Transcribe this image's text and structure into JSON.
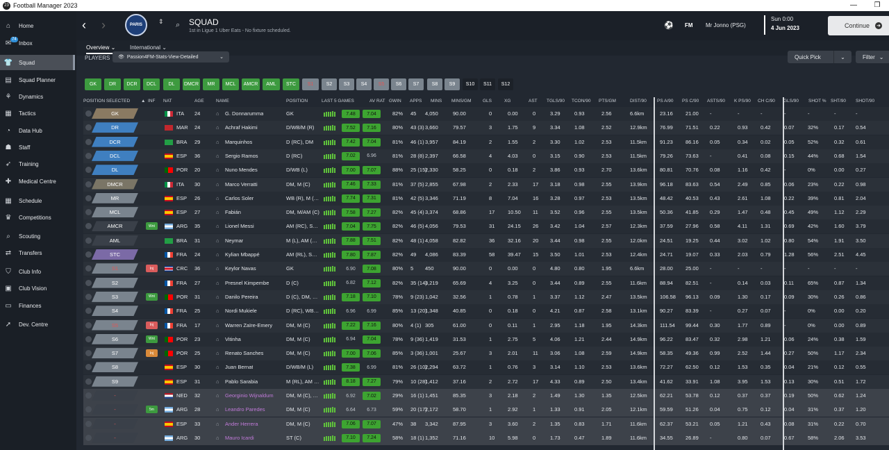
{
  "window": {
    "title": "Football Manager 2023",
    "logo_text": "23",
    "min": "—",
    "restore": "❐"
  },
  "sidebar": {
    "items": [
      {
        "label": "Home",
        "icon": "home-icon",
        "glyph": "⌂"
      },
      {
        "label": "Inbox",
        "icon": "inbox-icon",
        "glyph": "✉",
        "badge": "74"
      },
      {
        "label": "Squad",
        "icon": "shirt-icon",
        "glyph": "👕",
        "active": true
      },
      {
        "label": "Squad Planner",
        "icon": "planner-icon",
        "glyph": "▤"
      },
      {
        "label": "Dynamics",
        "icon": "dynamics-icon",
        "glyph": "⚘"
      },
      {
        "label": "Tactics",
        "icon": "tactics-icon",
        "glyph": "▦"
      },
      {
        "label": "Data Hub",
        "icon": "data-hub-icon",
        "glyph": "◔"
      },
      {
        "label": "Staff",
        "icon": "staff-icon",
        "glyph": "☗"
      },
      {
        "label": "Training",
        "icon": "training-icon",
        "glyph": "➶"
      },
      {
        "label": "Medical Centre",
        "icon": "medical-icon",
        "glyph": "✚"
      },
      {
        "label": "Schedule",
        "icon": "schedule-icon",
        "glyph": "▦"
      },
      {
        "label": "Competitions",
        "icon": "trophy-icon",
        "glyph": "♛"
      },
      {
        "label": "Scouting",
        "icon": "scouting-icon",
        "glyph": "⌕"
      },
      {
        "label": "Transfers",
        "icon": "transfers-icon",
        "glyph": "⇄"
      },
      {
        "label": "Club Info",
        "icon": "shield-icon",
        "glyph": "⛉"
      },
      {
        "label": "Club Vision",
        "icon": "vision-icon",
        "glyph": "▣"
      },
      {
        "label": "Finances",
        "icon": "finances-icon",
        "glyph": "▭"
      },
      {
        "label": "Dev. Centre",
        "icon": "dev-centre-icon",
        "glyph": "➚"
      }
    ]
  },
  "header": {
    "back": "‹",
    "forward": "›",
    "crest": "PARIS",
    "title": "SQUAD",
    "subtitle": "1st in Ligue 1 Uber Eats - No fixture scheduled.",
    "fm": "FM",
    "manager": "Mr Jonno (PSG)",
    "day": "Sun 0:00",
    "date": "4 Jun 2023",
    "continue": "Continue"
  },
  "tabs": {
    "overview": "Overview",
    "international": "International"
  },
  "players_label": "PLAYERS",
  "view": "Passion4FM-Stats-View-Detailed",
  "quick_pick": "Quick Pick",
  "filter": "Filter",
  "position_buttons": [
    "GK",
    "DR",
    "DCR",
    "DCL",
    "DL",
    "DMCR",
    "MR",
    "MCL",
    "AMCR",
    "AML",
    "STC",
    "S1",
    "S2",
    "S3",
    "S4",
    "S5",
    "S6",
    "S7",
    "S8",
    "S9",
    "S10",
    "S11",
    "S12"
  ],
  "columns": [
    "POSITION SELECTED",
    "INF",
    "NAT",
    "AGE",
    "NAME",
    "POSITION",
    "LAST 5 GAMES",
    "AV RAT",
    "GWIN",
    "APPS",
    "MINS",
    "MINS/GM",
    "GLS",
    "XG",
    "AST",
    "TGLS/90",
    "TCON/90",
    "PTS/GM",
    "DIST/90",
    "PS A/90",
    "PS C/90",
    "ASTS/90",
    "K PS/90",
    "CH C/90",
    "GLS/90",
    "SHOT %",
    "SHT/90",
    "SHOT/90"
  ],
  "sort_icon": "▲",
  "players": [
    {
      "sel": "GK",
      "inf": "",
      "nat": "ITA",
      "age": "24",
      "name": "G. Donnarumma",
      "pos": "GK",
      "l5": "7.48",
      "av": "7.04",
      "gwin": "82%",
      "apps": "45",
      "mins": "4,050",
      "mpg": "90.00",
      "gls": "0",
      "xg": "0.00",
      "ast": "0",
      "tgls": "3.29",
      "tcon": "0.93",
      "pts": "2.56",
      "dist": "6.6km",
      "psa": "23.16",
      "psc": "21.00",
      "asts": "-",
      "kps": "-",
      "chc": "-",
      "gls90": "-",
      "shotp": "-",
      "sht90": "-",
      "shot90": "-"
    },
    {
      "sel": "DR",
      "inf": "",
      "nat": "MAR",
      "age": "24",
      "name": "Achraf Hakimi",
      "pos": "D/WB/M (R)",
      "l5": "7.52",
      "av": "7.16",
      "gwin": "80%",
      "apps": "43 (3)",
      "mins": "3,660",
      "mpg": "79.57",
      "gls": "3",
      "xg": "1.75",
      "ast": "9",
      "tgls": "3.34",
      "tcon": "1.08",
      "pts": "2.52",
      "dist": "12.9km",
      "psa": "76.99",
      "psc": "71.51",
      "asts": "0.22",
      "kps": "0.93",
      "chc": "0.42",
      "gls90": "0.07",
      "shotp": "32%",
      "sht90": "0.17",
      "shot90": "0.54"
    },
    {
      "sel": "DCR",
      "inf": "",
      "nat": "BRA",
      "age": "29",
      "name": "Marquinhos",
      "pos": "D (RC), DM",
      "l5": "7.42",
      "av": "7.04",
      "gwin": "81%",
      "apps": "46 (1)",
      "mins": "3,957",
      "mpg": "84.19",
      "gls": "2",
      "xg": "1.55",
      "ast": "2",
      "tgls": "3.30",
      "tcon": "1.02",
      "pts": "2.53",
      "dist": "11.5km",
      "psa": "91.23",
      "psc": "86.16",
      "asts": "0.05",
      "kps": "0.34",
      "chc": "0.02",
      "gls90": "0.05",
      "shotp": "52%",
      "sht90": "0.32",
      "shot90": "0.61"
    },
    {
      "sel": "DCL",
      "inf": "",
      "nat": "ESP",
      "age": "36",
      "name": "Sergio Ramos",
      "pos": "D (RC)",
      "l5": "7.02",
      "av": "6.96",
      "gwin": "81%",
      "apps": "28 (8)",
      "mins": "2,397",
      "mpg": "66.58",
      "gls": "4",
      "xg": "4.03",
      "ast": "0",
      "tgls": "3.15",
      "tcon": "0.90",
      "pts": "2.53",
      "dist": "11.5km",
      "psa": "79.26",
      "psc": "73.63",
      "asts": "-",
      "kps": "0.41",
      "chc": "0.08",
      "gls90": "0.15",
      "shotp": "44%",
      "sht90": "0.68",
      "shot90": "1.54"
    },
    {
      "sel": "DL",
      "inf": "",
      "nat": "POR",
      "age": "20",
      "name": "Nuno Mendes",
      "pos": "D/WB (L)",
      "l5": "7.00",
      "av": "7.07",
      "gwin": "88%",
      "apps": "25 (15)",
      "mins": "2,330",
      "mpg": "58.25",
      "gls": "0",
      "xg": "0.18",
      "ast": "2",
      "tgls": "3.86",
      "tcon": "0.93",
      "pts": "2.70",
      "dist": "13.6km",
      "psa": "80.81",
      "psc": "70.76",
      "asts": "0.08",
      "kps": "1.16",
      "chc": "0.42",
      "gls90": "-",
      "shotp": "0%",
      "sht90": "0.00",
      "shot90": "0.27"
    },
    {
      "sel": "DMCR",
      "inf": "",
      "nat": "ITA",
      "age": "30",
      "name": "Marco Verratti",
      "pos": "DM, M (C)",
      "l5": "7.46",
      "av": "7.33",
      "gwin": "81%",
      "apps": "37 (5)",
      "mins": "2,855",
      "mpg": "67.98",
      "gls": "2",
      "xg": "2.33",
      "ast": "17",
      "tgls": "3.18",
      "tcon": "0.98",
      "pts": "2.55",
      "dist": "13.9km",
      "psa": "96.18",
      "psc": "83.63",
      "asts": "0.54",
      "kps": "2.49",
      "chc": "0.85",
      "gls90": "0.06",
      "shotp": "23%",
      "sht90": "0.22",
      "shot90": "0.98"
    },
    {
      "sel": "MR",
      "inf": "",
      "nat": "ESP",
      "age": "26",
      "name": "Carlos Soler",
      "pos": "WB (R), M (RC)",
      "l5": "7.74",
      "av": "7.31",
      "gwin": "81%",
      "apps": "42 (5)",
      "mins": "3,346",
      "mpg": "71.19",
      "gls": "8",
      "xg": "7.04",
      "ast": "16",
      "tgls": "3.28",
      "tcon": "0.97",
      "pts": "2.53",
      "dist": "13.5km",
      "psa": "48.42",
      "psc": "40.53",
      "asts": "0.43",
      "kps": "2.61",
      "chc": "1.08",
      "gls90": "0.22",
      "shotp": "39%",
      "sht90": "0.81",
      "shot90": "2.04"
    },
    {
      "sel": "MCL",
      "inf": "",
      "nat": "ESP",
      "age": "27",
      "name": "Fabián",
      "pos": "DM, M/AM (C)",
      "l5": "7.58",
      "av": "7.27",
      "gwin": "82%",
      "apps": "45 (4)",
      "mins": "3,374",
      "mpg": "68.86",
      "gls": "17",
      "xg": "10.50",
      "ast": "11",
      "tgls": "3.52",
      "tcon": "0.96",
      "pts": "2.55",
      "dist": "13.5km",
      "psa": "50.36",
      "psc": "41.85",
      "asts": "0.29",
      "kps": "1.47",
      "chc": "0.48",
      "gls90": "0.45",
      "shotp": "49%",
      "sht90": "1.12",
      "shot90": "2.29"
    },
    {
      "sel": "AMCR",
      "inf": "Wnt",
      "nat": "ARG",
      "age": "35",
      "name": "Lionel Messi",
      "pos": "AM (RC), ST (C)",
      "l5": "7.04",
      "av": "7.75",
      "gwin": "82%",
      "apps": "46 (5)",
      "mins": "4,056",
      "mpg": "79.53",
      "gls": "31",
      "xg": "24.15",
      "ast": "26",
      "tgls": "3.42",
      "tcon": "1.04",
      "pts": "2.57",
      "dist": "12.3km",
      "psa": "37.59",
      "psc": "27.96",
      "asts": "0.58",
      "kps": "4.11",
      "chc": "1.31",
      "gls90": "0.69",
      "shotp": "42%",
      "sht90": "1.60",
      "shot90": "3.79"
    },
    {
      "sel": "AML",
      "inf": "",
      "nat": "BRA",
      "age": "31",
      "name": "Neymar",
      "pos": "M (L), AM (LC)",
      "l5": "7.88",
      "av": "7.51",
      "gwin": "82%",
      "apps": "48 (1)",
      "mins": "4,058",
      "mpg": "82.82",
      "gls": "36",
      "xg": "32.16",
      "ast": "20",
      "tgls": "3.44",
      "tcon": "0.98",
      "pts": "2.55",
      "dist": "12.0km",
      "psa": "24.51",
      "psc": "19.25",
      "asts": "0.44",
      "kps": "3.02",
      "chc": "1.02",
      "gls90": "0.80",
      "shotp": "54%",
      "sht90": "1.91",
      "shot90": "3.50"
    },
    {
      "sel": "STC",
      "inf": "",
      "nat": "FRA",
      "age": "24",
      "name": "Kylian Mbappé",
      "pos": "AM (RL), ST (C)",
      "l5": "7.80",
      "av": "7.87",
      "gwin": "82%",
      "apps": "49",
      "mins": "4,086",
      "mpg": "83.39",
      "gls": "58",
      "xg": "39.47",
      "ast": "15",
      "tgls": "3.50",
      "tcon": "1.01",
      "pts": "2.53",
      "dist": "12.4km",
      "psa": "24.71",
      "psc": "19.07",
      "asts": "0.33",
      "kps": "2.03",
      "chc": "0.79",
      "gls90": "1.28",
      "shotp": "56%",
      "sht90": "2.51",
      "shot90": "4.45"
    },
    {
      "sel": "S1",
      "inf": "Inj",
      "nat": "CRC",
      "age": "36",
      "name": "Keylor Navas",
      "pos": "GK",
      "l5": "6.90",
      "av": "7.08",
      "gwin": "80%",
      "apps": "5",
      "mins": "450",
      "mpg": "90.00",
      "gls": "0",
      "xg": "0.00",
      "ast": "0",
      "tgls": "4.80",
      "tcon": "0.80",
      "pts": "1.95",
      "dist": "6.6km",
      "psa": "28.00",
      "psc": "25.00",
      "asts": "-",
      "kps": "-",
      "chc": "-",
      "gls90": "-",
      "shotp": "-",
      "sht90": "-",
      "shot90": "-"
    },
    {
      "sel": "S2",
      "inf": "",
      "nat": "FRA",
      "age": "27",
      "name": "Presnel Kimpembe",
      "pos": "D (C)",
      "l5": "6.82",
      "av": "7.12",
      "gwin": "82%",
      "apps": "35 (14)",
      "mins": "3,219",
      "mpg": "65.69",
      "gls": "4",
      "xg": "3.25",
      "ast": "0",
      "tgls": "3.44",
      "tcon": "0.89",
      "pts": "2.55",
      "dist": "11.6km",
      "psa": "88.94",
      "psc": "82.51",
      "asts": "-",
      "kps": "0.14",
      "chc": "0.03",
      "gls90": "0.11",
      "shotp": "65%",
      "sht90": "0.87",
      "shot90": "1.34"
    },
    {
      "sel": "S3",
      "inf": "Wnt",
      "nat": "POR",
      "age": "31",
      "name": "Danilo Pereira",
      "pos": "D (C), DM, M (C)",
      "l5": "7.18",
      "av": "7.10",
      "gwin": "78%",
      "apps": "9 (23)",
      "mins": "1,042",
      "mpg": "32.56",
      "gls": "1",
      "xg": "0.78",
      "ast": "1",
      "tgls": "3.37",
      "tcon": "1.12",
      "pts": "2.47",
      "dist": "13.5km",
      "psa": "106.58",
      "psc": "96.13",
      "asts": "0.09",
      "kps": "1.30",
      "chc": "0.17",
      "gls90": "0.09",
      "shotp": "30%",
      "sht90": "0.26",
      "shot90": "0.86"
    },
    {
      "sel": "S4",
      "inf": "",
      "nat": "FRA",
      "age": "25",
      "name": "Nordi Mukiele",
      "pos": "D (RC), WB (R)",
      "l5": "6.96",
      "av": "6.99",
      "gwin": "85%",
      "apps": "13 (20)",
      "mins": "1,348",
      "mpg": "40.85",
      "gls": "0",
      "xg": "0.18",
      "ast": "0",
      "tgls": "4.21",
      "tcon": "0.87",
      "pts": "2.58",
      "dist": "13.1km",
      "psa": "90.27",
      "psc": "83.39",
      "asts": "-",
      "kps": "0.27",
      "chc": "0.07",
      "gls90": "-",
      "shotp": "0%",
      "sht90": "0.00",
      "shot90": "0.20"
    },
    {
      "sel": "S5",
      "inf": "Inj",
      "nat": "FRA",
      "age": "17",
      "name": "Warren Zaïre-Emery",
      "pos": "DM, M (C)",
      "l5": "7.22",
      "av": "7.16",
      "gwin": "80%",
      "apps": "4 (1)",
      "mins": "305",
      "mpg": "61.00",
      "gls": "0",
      "xg": "0.11",
      "ast": "1",
      "tgls": "2.95",
      "tcon": "1.18",
      "pts": "1.95",
      "dist": "14.3km",
      "psa": "111.54",
      "psc": "99.44",
      "asts": "0.30",
      "kps": "1.77",
      "chc": "0.89",
      "gls90": "-",
      "shotp": "0%",
      "sht90": "0.00",
      "shot90": "0.89"
    },
    {
      "sel": "S6",
      "inf": "Wnt",
      "nat": "POR",
      "age": "23",
      "name": "Vitinha",
      "pos": "DM, M (C)",
      "l5": "6.94",
      "av": "7.04",
      "gwin": "78%",
      "apps": "9 (36)",
      "mins": "1,419",
      "mpg": "31.53",
      "gls": "1",
      "xg": "2.75",
      "ast": "5",
      "tgls": "4.06",
      "tcon": "1.21",
      "pts": "2.44",
      "dist": "14.9km",
      "psa": "96.22",
      "psc": "83.47",
      "asts": "0.32",
      "kps": "2.98",
      "chc": "1.21",
      "gls90": "0.06",
      "shotp": "24%",
      "sht90": "0.38",
      "shot90": "1.59"
    },
    {
      "sel": "S7",
      "inf": "Inj",
      "nat": "POR",
      "age": "25",
      "name": "Renato Sanches",
      "pos": "DM, M (C)",
      "l5": "7.00",
      "av": "7.06",
      "gwin": "85%",
      "apps": "3 (36)",
      "mins": "1,001",
      "mpg": "25.67",
      "gls": "3",
      "xg": "2.01",
      "ast": "11",
      "tgls": "3.06",
      "tcon": "1.08",
      "pts": "2.59",
      "dist": "14.9km",
      "psa": "58.35",
      "psc": "49.36",
      "asts": "0.99",
      "kps": "2.52",
      "chc": "1.44",
      "gls90": "0.27",
      "shotp": "50%",
      "sht90": "1.17",
      "shot90": "2.34"
    },
    {
      "sel": "S8",
      "inf": "",
      "nat": "ESP",
      "age": "30",
      "name": "Juan Bernat",
      "pos": "D/WB/M (L)",
      "l5": "7.38",
      "av": "6.99",
      "gwin": "81%",
      "apps": "26 (10)",
      "mins": "2,294",
      "mpg": "63.72",
      "gls": "1",
      "xg": "0.76",
      "ast": "3",
      "tgls": "3.14",
      "tcon": "1.10",
      "pts": "2.53",
      "dist": "13.6km",
      "psa": "72.27",
      "psc": "62.50",
      "asts": "0.12",
      "kps": "1.53",
      "chc": "0.35",
      "gls90": "0.04",
      "shotp": "21%",
      "sht90": "0.12",
      "shot90": "0.55"
    },
    {
      "sel": "S9",
      "inf": "",
      "nat": "ESP",
      "age": "31",
      "name": "Pablo Sarabia",
      "pos": "M (RL), AM (RL)",
      "l5": "8.18",
      "av": "7.27",
      "gwin": "79%",
      "apps": "10 (28)",
      "mins": "1,412",
      "mpg": "37.16",
      "gls": "2",
      "xg": "2.72",
      "ast": "17",
      "tgls": "4.33",
      "tcon": "0.89",
      "pts": "2.50",
      "dist": "13.4km",
      "psa": "41.62",
      "psc": "33.91",
      "asts": "1.08",
      "kps": "3.95",
      "chc": "1.53",
      "gls90": "0.13",
      "shotp": "30%",
      "sht90": "0.51",
      "shot90": "1.72"
    },
    {
      "sel": "-",
      "inf": "",
      "nat": "NED",
      "age": "32",
      "name": "Georginio Wijnaldum",
      "pos": "DM, M (C), AM (C)",
      "l5": "6.92",
      "av": "7.02",
      "gwin": "29%",
      "apps": "16 (1)",
      "mins": "1,451",
      "mpg": "85.35",
      "gls": "3",
      "xg": "2.18",
      "ast": "2",
      "tgls": "1.49",
      "tcon": "1.30",
      "pts": "1.35",
      "dist": "12.5km",
      "psa": "62.21",
      "psc": "53.78",
      "asts": "0.12",
      "kps": "0.37",
      "chc": "0.37",
      "gls90": "0.19",
      "shotp": "50%",
      "sht90": "0.62",
      "shot90": "1.24",
      "loan": true
    },
    {
      "sel": "-",
      "inf": "5m",
      "nat": "ARG",
      "age": "28",
      "name": "Leandro Paredes",
      "pos": "DM, M (C)",
      "l5": "6.64",
      "av": "6.73",
      "gwin": "59%",
      "apps": "20 (17)",
      "mins": "2,172",
      "mpg": "58.70",
      "gls": "1",
      "xg": "2.92",
      "ast": "1",
      "tgls": "1.33",
      "tcon": "0.91",
      "pts": "2.05",
      "dist": "12.1km",
      "psa": "59.59",
      "psc": "51.26",
      "asts": "0.04",
      "kps": "0.75",
      "chc": "0.12",
      "gls90": "0.04",
      "shotp": "31%",
      "sht90": "0.37",
      "shot90": "1.20",
      "loan": true
    },
    {
      "sel": "-",
      "inf": "",
      "nat": "ESP",
      "age": "33",
      "name": "Ander Herrera",
      "pos": "DM, M (C)",
      "l5": "7.06",
      "av": "7.07",
      "gwin": "47%",
      "apps": "38",
      "mins": "3,342",
      "mpg": "87.95",
      "gls": "3",
      "xg": "3.60",
      "ast": "2",
      "tgls": "1.35",
      "tcon": "0.83",
      "pts": "1.71",
      "dist": "11.6km",
      "psa": "62.37",
      "psc": "53.21",
      "asts": "0.05",
      "kps": "1.21",
      "chc": "0.43",
      "gls90": "0.08",
      "shotp": "31%",
      "sht90": "0.22",
      "shot90": "0.70",
      "loan": true
    },
    {
      "sel": "-",
      "inf": "",
      "nat": "ARG",
      "age": "30",
      "name": "Mauro Icardi",
      "pos": "ST (C)",
      "l5": "7.10",
      "av": "7.24",
      "gwin": "58%",
      "apps": "18 (1)",
      "mins": "1,352",
      "mpg": "71.16",
      "gls": "10",
      "xg": "5.98",
      "ast": "0",
      "tgls": "1.73",
      "tcon": "0.47",
      "pts": "1.89",
      "dist": "11.6km",
      "psa": "34.55",
      "psc": "26.89",
      "asts": "-",
      "kps": "0.80",
      "chc": "0.07",
      "gls90": "0.67",
      "shotp": "58%",
      "sht90": "2.06",
      "shot90": "3.53",
      "loan": true
    }
  ],
  "colors": {
    "green": "#3d9a3f",
    "accent": "#5fc33b",
    "loan_name": "#c07ad8"
  }
}
